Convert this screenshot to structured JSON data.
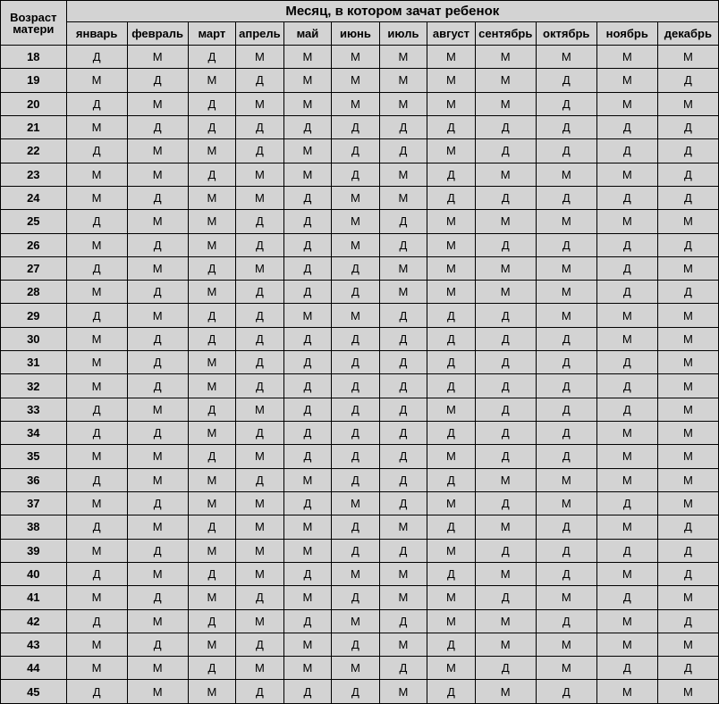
{
  "header": {
    "age_label": "Возраст матери",
    "months_label": "Месяц, в котором зачат ребенок"
  },
  "months": [
    "январь",
    "февраль",
    "март",
    "апрель",
    "май",
    "июнь",
    "июль",
    "август",
    "сентябрь",
    "октябрь",
    "ноябрь",
    "декабрь"
  ],
  "rows": [
    {
      "age": "18",
      "cells": [
        "Д",
        "М",
        "Д",
        "М",
        "М",
        "М",
        "М",
        "М",
        "М",
        "М",
        "М",
        "М"
      ]
    },
    {
      "age": "19",
      "cells": [
        "М",
        "Д",
        "М",
        "Д",
        "М",
        "М",
        "М",
        "М",
        "М",
        "Д",
        "М",
        "Д"
      ]
    },
    {
      "age": "20",
      "cells": [
        "Д",
        "М",
        "Д",
        "М",
        "М",
        "М",
        "М",
        "М",
        "М",
        "Д",
        "М",
        "М"
      ]
    },
    {
      "age": "21",
      "cells": [
        "М",
        "Д",
        "Д",
        "Д",
        "Д",
        "Д",
        "Д",
        "Д",
        "Д",
        "Д",
        "Д",
        "Д"
      ]
    },
    {
      "age": "22",
      "cells": [
        "Д",
        "М",
        "М",
        "Д",
        "М",
        "Д",
        "Д",
        "М",
        "Д",
        "Д",
        "Д",
        "Д"
      ]
    },
    {
      "age": "23",
      "cells": [
        "М",
        "М",
        "Д",
        "М",
        "М",
        "Д",
        "М",
        "Д",
        "М",
        "М",
        "М",
        "Д"
      ]
    },
    {
      "age": "24",
      "cells": [
        "М",
        "Д",
        "М",
        "М",
        "Д",
        "М",
        "М",
        "Д",
        "Д",
        "Д",
        "Д",
        "Д"
      ]
    },
    {
      "age": "25",
      "cells": [
        "Д",
        "М",
        "М",
        "Д",
        "Д",
        "М",
        "Д",
        "М",
        "М",
        "М",
        "М",
        "М"
      ]
    },
    {
      "age": "26",
      "cells": [
        "М",
        "Д",
        "М",
        "Д",
        "Д",
        "М",
        "Д",
        "М",
        "Д",
        "Д",
        "Д",
        "Д"
      ]
    },
    {
      "age": "27",
      "cells": [
        "Д",
        "М",
        "Д",
        "М",
        "Д",
        "Д",
        "М",
        "М",
        "М",
        "М",
        "Д",
        "М"
      ]
    },
    {
      "age": "28",
      "cells": [
        "М",
        "Д",
        "М",
        "Д",
        "Д",
        "Д",
        "М",
        "М",
        "М",
        "М",
        "Д",
        "Д"
      ]
    },
    {
      "age": "29",
      "cells": [
        "Д",
        "М",
        "Д",
        "Д",
        "М",
        "М",
        "Д",
        "Д",
        "Д",
        "М",
        "М",
        "М"
      ]
    },
    {
      "age": "30",
      "cells": [
        "М",
        "Д",
        "Д",
        "Д",
        "Д",
        "Д",
        "Д",
        "Д",
        "Д",
        "Д",
        "М",
        "М"
      ]
    },
    {
      "age": "31",
      "cells": [
        "М",
        "Д",
        "М",
        "Д",
        "Д",
        "Д",
        "Д",
        "Д",
        "Д",
        "Д",
        "Д",
        "М"
      ]
    },
    {
      "age": "32",
      "cells": [
        "М",
        "Д",
        "М",
        "Д",
        "Д",
        "Д",
        "Д",
        "Д",
        "Д",
        "Д",
        "Д",
        "М"
      ]
    },
    {
      "age": "33",
      "cells": [
        "Д",
        "М",
        "Д",
        "М",
        "Д",
        "Д",
        "Д",
        "М",
        "Д",
        "Д",
        "Д",
        "М"
      ]
    },
    {
      "age": "34",
      "cells": [
        "Д",
        "Д",
        "М",
        "Д",
        "Д",
        "Д",
        "Д",
        "Д",
        "Д",
        "Д",
        "М",
        "М"
      ]
    },
    {
      "age": "35",
      "cells": [
        "М",
        "М",
        "Д",
        "М",
        "Д",
        "Д",
        "Д",
        "М",
        "Д",
        "Д",
        "М",
        "М"
      ]
    },
    {
      "age": "36",
      "cells": [
        "Д",
        "М",
        "М",
        "Д",
        "М",
        "Д",
        "Д",
        "Д",
        "М",
        "М",
        "М",
        "М"
      ]
    },
    {
      "age": "37",
      "cells": [
        "М",
        "Д",
        "М",
        "М",
        "Д",
        "М",
        "Д",
        "М",
        "Д",
        "М",
        "Д",
        "М"
      ]
    },
    {
      "age": "38",
      "cells": [
        "Д",
        "М",
        "Д",
        "М",
        "М",
        "Д",
        "М",
        "Д",
        "М",
        "Д",
        "М",
        "Д"
      ]
    },
    {
      "age": "39",
      "cells": [
        "М",
        "Д",
        "М",
        "М",
        "М",
        "Д",
        "Д",
        "М",
        "Д",
        "Д",
        "Д",
        "Д"
      ]
    },
    {
      "age": "40",
      "cells": [
        "Д",
        "М",
        "Д",
        "М",
        "Д",
        "М",
        "М",
        "Д",
        "М",
        "Д",
        "М",
        "Д"
      ]
    },
    {
      "age": "41",
      "cells": [
        "М",
        "Д",
        "М",
        "Д",
        "М",
        "Д",
        "М",
        "М",
        "Д",
        "М",
        "Д",
        "М"
      ]
    },
    {
      "age": "42",
      "cells": [
        "Д",
        "М",
        "Д",
        "М",
        "Д",
        "М",
        "Д",
        "М",
        "М",
        "Д",
        "М",
        "Д"
      ]
    },
    {
      "age": "43",
      "cells": [
        "М",
        "Д",
        "М",
        "Д",
        "М",
        "Д",
        "М",
        "Д",
        "М",
        "М",
        "М",
        "М"
      ]
    },
    {
      "age": "44",
      "cells": [
        "М",
        "М",
        "Д",
        "М",
        "М",
        "М",
        "Д",
        "М",
        "Д",
        "М",
        "Д",
        "Д"
      ]
    },
    {
      "age": "45",
      "cells": [
        "Д",
        "М",
        "М",
        "Д",
        "Д",
        "Д",
        "М",
        "Д",
        "М",
        "Д",
        "М",
        "М"
      ]
    }
  ],
  "chart_data": {
    "type": "table",
    "title": "Месяц, в котором зачат ребенок",
    "row_label": "Возраст матери",
    "columns": [
      "январь",
      "февраль",
      "март",
      "апрель",
      "май",
      "июнь",
      "июль",
      "август",
      "сентябрь",
      "октябрь",
      "ноябрь",
      "декабрь"
    ],
    "index": [
      "18",
      "19",
      "20",
      "21",
      "22",
      "23",
      "24",
      "25",
      "26",
      "27",
      "28",
      "29",
      "30",
      "31",
      "32",
      "33",
      "34",
      "35",
      "36",
      "37",
      "38",
      "39",
      "40",
      "41",
      "42",
      "43",
      "44",
      "45"
    ],
    "values": [
      [
        "Д",
        "М",
        "Д",
        "М",
        "М",
        "М",
        "М",
        "М",
        "М",
        "М",
        "М",
        "М"
      ],
      [
        "М",
        "Д",
        "М",
        "Д",
        "М",
        "М",
        "М",
        "М",
        "М",
        "Д",
        "М",
        "Д"
      ],
      [
        "Д",
        "М",
        "Д",
        "М",
        "М",
        "М",
        "М",
        "М",
        "М",
        "Д",
        "М",
        "М"
      ],
      [
        "М",
        "Д",
        "Д",
        "Д",
        "Д",
        "Д",
        "Д",
        "Д",
        "Д",
        "Д",
        "Д",
        "Д"
      ],
      [
        "Д",
        "М",
        "М",
        "Д",
        "М",
        "Д",
        "Д",
        "М",
        "Д",
        "Д",
        "Д",
        "Д"
      ],
      [
        "М",
        "М",
        "Д",
        "М",
        "М",
        "Д",
        "М",
        "Д",
        "М",
        "М",
        "М",
        "Д"
      ],
      [
        "М",
        "Д",
        "М",
        "М",
        "Д",
        "М",
        "М",
        "Д",
        "Д",
        "Д",
        "Д",
        "Д"
      ],
      [
        "Д",
        "М",
        "М",
        "Д",
        "Д",
        "М",
        "Д",
        "М",
        "М",
        "М",
        "М",
        "М"
      ],
      [
        "М",
        "Д",
        "М",
        "Д",
        "Д",
        "М",
        "Д",
        "М",
        "Д",
        "Д",
        "Д",
        "Д"
      ],
      [
        "Д",
        "М",
        "Д",
        "М",
        "Д",
        "Д",
        "М",
        "М",
        "М",
        "М",
        "Д",
        "М"
      ],
      [
        "М",
        "Д",
        "М",
        "Д",
        "Д",
        "Д",
        "М",
        "М",
        "М",
        "М",
        "Д",
        "Д"
      ],
      [
        "Д",
        "М",
        "Д",
        "Д",
        "М",
        "М",
        "Д",
        "Д",
        "Д",
        "М",
        "М",
        "М"
      ],
      [
        "М",
        "Д",
        "Д",
        "Д",
        "Д",
        "Д",
        "Д",
        "Д",
        "Д",
        "Д",
        "М",
        "М"
      ],
      [
        "М",
        "Д",
        "М",
        "Д",
        "Д",
        "Д",
        "Д",
        "Д",
        "Д",
        "Д",
        "Д",
        "М"
      ],
      [
        "М",
        "Д",
        "М",
        "Д",
        "Д",
        "Д",
        "Д",
        "Д",
        "Д",
        "Д",
        "Д",
        "М"
      ],
      [
        "Д",
        "М",
        "Д",
        "М",
        "Д",
        "Д",
        "Д",
        "М",
        "Д",
        "Д",
        "Д",
        "М"
      ],
      [
        "Д",
        "Д",
        "М",
        "Д",
        "Д",
        "Д",
        "Д",
        "Д",
        "Д",
        "Д",
        "М",
        "М"
      ],
      [
        "М",
        "М",
        "Д",
        "М",
        "Д",
        "Д",
        "Д",
        "М",
        "Д",
        "Д",
        "М",
        "М"
      ],
      [
        "Д",
        "М",
        "М",
        "Д",
        "М",
        "Д",
        "Д",
        "Д",
        "М",
        "М",
        "М",
        "М"
      ],
      [
        "М",
        "Д",
        "М",
        "М",
        "Д",
        "М",
        "Д",
        "М",
        "Д",
        "М",
        "Д",
        "М"
      ],
      [
        "Д",
        "М",
        "Д",
        "М",
        "М",
        "Д",
        "М",
        "Д",
        "М",
        "Д",
        "М",
        "Д"
      ],
      [
        "М",
        "Д",
        "М",
        "М",
        "М",
        "Д",
        "Д",
        "М",
        "Д",
        "Д",
        "Д",
        "Д"
      ],
      [
        "Д",
        "М",
        "Д",
        "М",
        "Д",
        "М",
        "М",
        "Д",
        "М",
        "Д",
        "М",
        "Д"
      ],
      [
        "М",
        "Д",
        "М",
        "Д",
        "М",
        "Д",
        "М",
        "М",
        "Д",
        "М",
        "Д",
        "М"
      ],
      [
        "Д",
        "М",
        "Д",
        "М",
        "Д",
        "М",
        "Д",
        "М",
        "М",
        "Д",
        "М",
        "Д"
      ],
      [
        "М",
        "Д",
        "М",
        "Д",
        "М",
        "Д",
        "М",
        "Д",
        "М",
        "М",
        "М",
        "М"
      ],
      [
        "М",
        "М",
        "Д",
        "М",
        "М",
        "М",
        "Д",
        "М",
        "Д",
        "М",
        "Д",
        "Д"
      ],
      [
        "Д",
        "М",
        "М",
        "Д",
        "Д",
        "Д",
        "М",
        "Д",
        "М",
        "Д",
        "М",
        "М"
      ]
    ]
  }
}
